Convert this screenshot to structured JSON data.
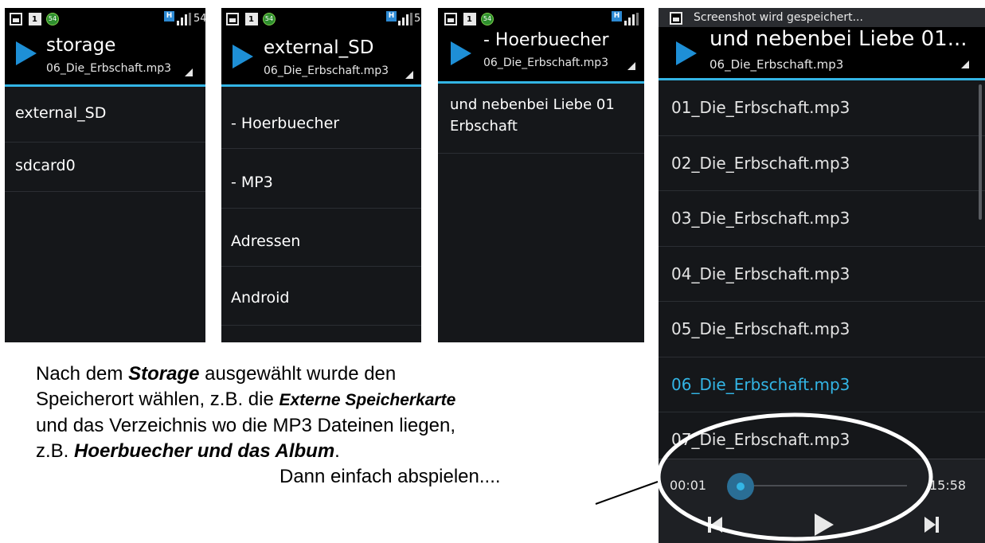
{
  "screens": [
    {
      "status": {
        "right_text": "54"
      },
      "title": "storage",
      "subtitle": "06_Die_Erbschaft.mp3",
      "items": [
        "external_SD",
        "sdcard0"
      ]
    },
    {
      "status": {
        "right_text": "5"
      },
      "title": "external_SD",
      "subtitle": "06_Die_Erbschaft.mp3",
      "items": [
        "- Hoerbuecher",
        "- MP3",
        "Adressen",
        "Android"
      ]
    },
    {
      "status": {
        "right_text": ""
      },
      "title": "- Hoerbuecher",
      "subtitle": "06_Die_Erbschaft.mp3",
      "items": [
        {
          "line1": "und nebenbei Liebe 01",
          "line2": "Erbschaft"
        }
      ]
    },
    {
      "status_text": "Screenshot wird gespeichert...",
      "title": "und nebenbei Liebe 01...",
      "subtitle": "06_Die_Erbschaft.mp3",
      "tracks": [
        "01_Die_Erbschaft.mp3",
        "02_Die_Erbschaft.mp3",
        "03_Die_Erbschaft.mp3",
        "04_Die_Erbschaft.mp3",
        "05_Die_Erbschaft.mp3",
        "06_Die_Erbschaft.mp3",
        "07_Die_Erbschaft.mp3"
      ],
      "active_track_index": 5,
      "player": {
        "elapsed": "00:01",
        "duration": "15:58",
        "progress": 0.01
      }
    }
  ],
  "caption": {
    "l1_a": "Nach dem ",
    "l1_b": "Storage",
    "l1_c": " ausgewählt wurde den",
    "l2_a": "Speicherort wählen, z.B. die ",
    "l2_b": "Externe Speicherkarte",
    "l3": "und das Verzeichnis wo die MP3 Dateinen liegen,",
    "l4_a": "z.B. ",
    "l4_b": "Hoerbuecher und das Album",
    "l4_c": ".",
    "l5": "Dann einfach abspielen...."
  },
  "colors": {
    "accent": "#33b5e5",
    "play_triangle": "#1e8fd6",
    "background": "#15171a"
  },
  "icons": [
    "picture-icon",
    "calendar-icon",
    "battery-54-icon",
    "hspa-icon",
    "signal-icon",
    "play-triangle-icon",
    "previous-icon",
    "play-icon",
    "next-icon"
  ]
}
